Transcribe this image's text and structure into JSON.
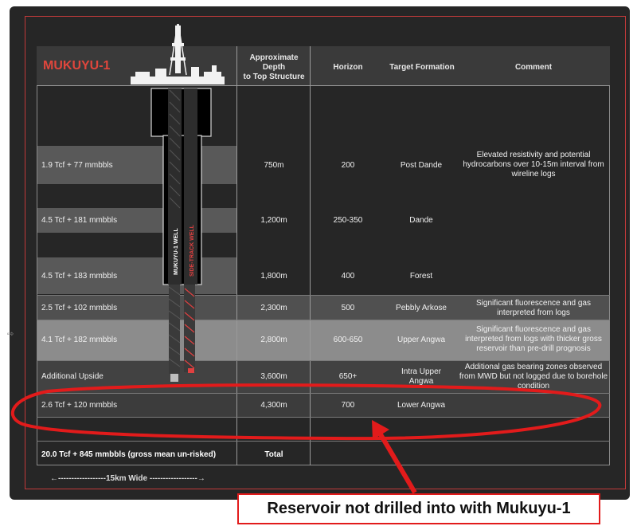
{
  "header": {
    "title": "MUKUYU-1",
    "col_depth": "Approximate\nDepth\nto Top Structure",
    "col_horizon": "Horizon",
    "col_formation": "Target Formation",
    "col_comment": "Comment"
  },
  "rows": [
    {
      "name": "1.9 Tcf + 77 mmbbls",
      "depth": "750m",
      "horizon": "200",
      "formation": "Post Dande",
      "comment": "Elevated resistivity and potential hydrocarbons over 10-15m interval from wireline logs"
    },
    {
      "name": "4.5 Tcf + 181 mmbbls",
      "depth": "1,200m",
      "horizon": "250-350",
      "formation": "Dande",
      "comment": ""
    },
    {
      "name": "4.5 Tcf + 183 mmbbls",
      "depth": "1,800m",
      "horizon": "400",
      "formation": "Forest",
      "comment": ""
    },
    {
      "name": "2.5 Tcf + 102 mmbbls",
      "depth": "2,300m",
      "horizon": "500",
      "formation": "Pebbly Arkose",
      "comment": "Significant fluorescence and gas interpreted from logs"
    },
    {
      "name": "4.1 Tcf + 182 mmbbls",
      "depth": "2,800m",
      "horizon": "600-650",
      "formation": "Upper Angwa",
      "comment": "Significant fluorescence and gas interpreted from logs with thicker gross reservoir than pre-drill prognosis"
    },
    {
      "name": "Additional Upside",
      "depth": "3,600m",
      "horizon": "650+",
      "formation": "Intra Upper Angwa",
      "comment": "Additional gas bearing zones observed from MWD but not logged due to borehole condition"
    },
    {
      "name": "2.6 Tcf + 120 mmbbls",
      "depth": "4,300m",
      "horizon": "700",
      "formation": "Lower Angwa",
      "comment": ""
    }
  ],
  "total": {
    "name": "20.0 Tcf + 845 mmbbls (gross mean un-risked)",
    "label": "Total"
  },
  "scale": "←------------------15km Wide ------------------→",
  "well": {
    "main_label": "MUKUYU-1 WELL",
    "side_label": "SIDE-TRACK WELL"
  },
  "annotation": "Reservoir not drilled into with Mukuyu-1",
  "colors": {
    "title_red": "#e0463c",
    "annotation_red": "#e21b1b",
    "sidetrack_red": "#e04040"
  },
  "icons": [
    "drilling-rig-icon",
    "well-bore-icon",
    "side-track-icon"
  ]
}
